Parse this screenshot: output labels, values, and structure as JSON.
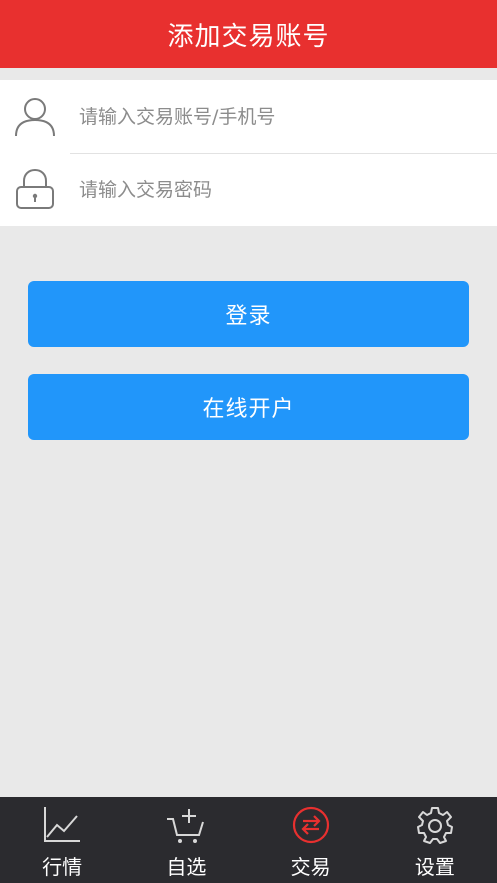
{
  "header": {
    "title": "添加交易账号"
  },
  "form": {
    "account": {
      "placeholder": "请输入交易账号/手机号",
      "icon": "user-icon"
    },
    "password": {
      "placeholder": "请输入交易密码",
      "icon": "lock-icon"
    }
  },
  "buttons": {
    "login_label": "登录",
    "open_account_label": "在线开户"
  },
  "tabbar": {
    "tabs": [
      {
        "label": "行情",
        "icon": "chart-icon",
        "active": false
      },
      {
        "label": "自选",
        "icon": "cart-add-icon",
        "active": false
      },
      {
        "label": "交易",
        "icon": "exchange-icon",
        "active": true
      },
      {
        "label": "设置",
        "icon": "gear-icon",
        "active": false
      }
    ]
  },
  "colors": {
    "header_bg": "#e8302f",
    "button_bg": "#2196fa",
    "tabbar_bg": "#2b2b2f",
    "active_tab": "#e8302f"
  }
}
